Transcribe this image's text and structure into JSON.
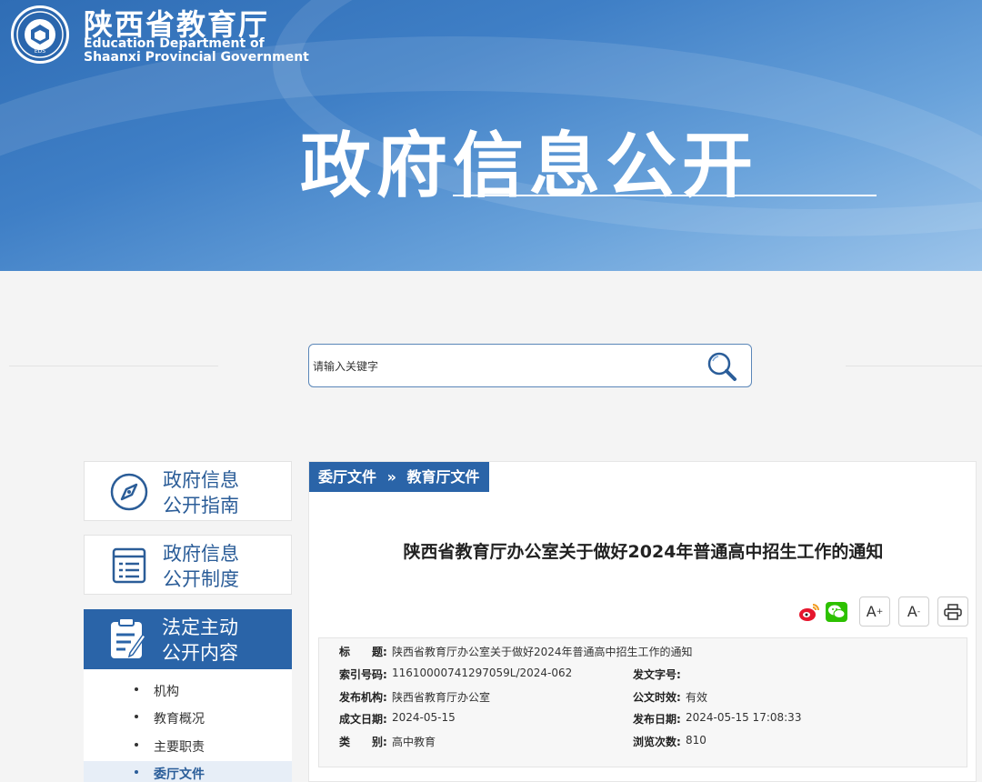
{
  "header": {
    "org_cn": "陕西省教育厅",
    "org_en_line1": "Education Department of",
    "org_en_line2": "Shaanxi Provincial Government",
    "logo_abbr": "EDS",
    "banner_title": "政府信息公开"
  },
  "search": {
    "placeholder": "请输入关键字"
  },
  "sidebar": {
    "cards": [
      {
        "label": "政府信息\n公开指南",
        "icon": "compass-icon"
      },
      {
        "label": "政府信息\n公开制度",
        "icon": "list-document-icon"
      }
    ],
    "active": {
      "label": "法定主动\n公开内容",
      "icon": "clipboard-edit-icon"
    },
    "sub_items": [
      {
        "label": "机构",
        "active": false
      },
      {
        "label": "教育概况",
        "active": false
      },
      {
        "label": "主要职责",
        "active": false
      },
      {
        "label": "委厅文件",
        "active": true
      }
    ]
  },
  "breadcrumb": {
    "part1": "委厅文件",
    "sep": "»",
    "part2": "教育厅文件"
  },
  "document": {
    "title": "陕西省教育厅办公室关于做好2024年普通高中招生工作的通知"
  },
  "toolbar": {
    "font_larger": "A",
    "font_smaller": "A",
    "sup_plus": "+",
    "sup_minus": "-",
    "share_icons": [
      "weibo-icon",
      "wechat-icon"
    ],
    "print_icon": "printer-icon"
  },
  "meta": {
    "title_label": "标　　题:",
    "title_value": "陕西省教育厅办公室关于做好2024年普通高中招生工作的通知",
    "index_label": "索引号码:",
    "index_value": "11610000741297059L/2024-062",
    "doc_no_label": "发文字号:",
    "doc_no_value": "",
    "issuer_label": "发布机构:",
    "issuer_value": "陕西省教育厅办公室",
    "validity_label": "公文时效:",
    "validity_value": "有效",
    "created_label": "成文日期:",
    "created_value": "2024-05-15",
    "published_label": "发布日期:",
    "published_value": "2024-05-15 17:08:33",
    "category_label": "类　　别:",
    "category_value": "高中教育",
    "views_label": "浏览次数:",
    "views_value": "810"
  },
  "colors": {
    "primary": "#2a64a8",
    "banner_start": "#2f6db5",
    "banner_end": "#9cc4ea",
    "page_bg": "#f4f4f4"
  }
}
